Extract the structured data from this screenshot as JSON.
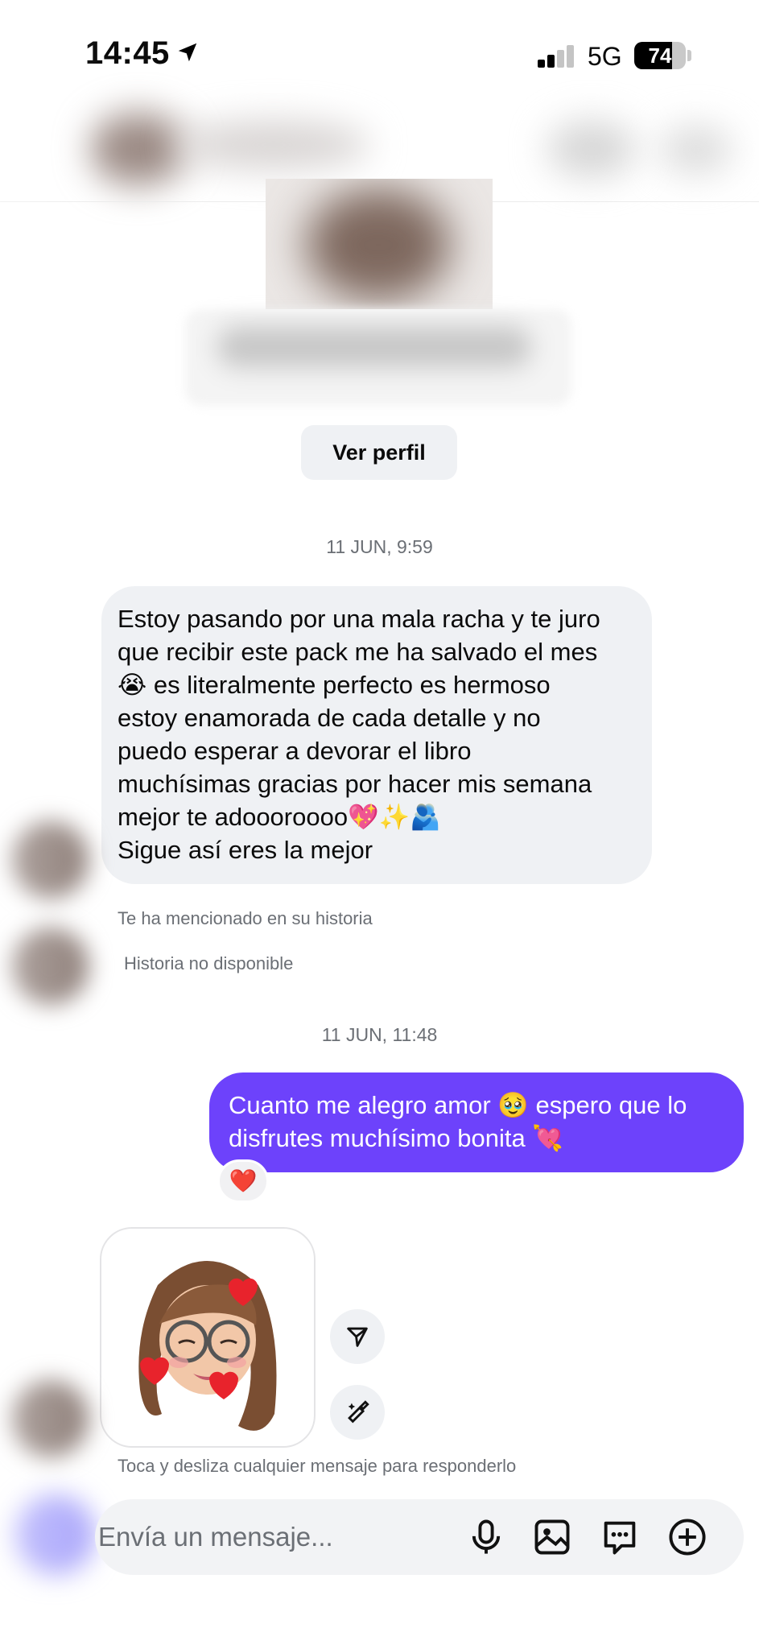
{
  "status_bar": {
    "time": "14:45",
    "network": "5G",
    "battery": "74",
    "battery_level": 0.74,
    "signal_bars_filled": 2,
    "signal_bars_total": 4
  },
  "profile": {
    "view_profile_label": "Ver perfil"
  },
  "thread": {
    "timestamp_1": "11 JUN, 9:59",
    "incoming_message_lines": [
      "Estoy pasando por una mala racha y te juro",
      "que recibir este pack me ha salvado el mes",
      "😭 es literalmente perfecto es hermoso",
      "estoy enamorada de cada detalle y no",
      "puedo esperar a devorar el libro",
      "muchísimas gracias por hacer mis semana",
      "mejor te adoooroooo💖✨🫂",
      "Sigue así eres la mejor"
    ],
    "mention_text": "Te ha mencionado en su historia",
    "story_unavailable": "Historia no disponible",
    "timestamp_2": "11 JUN, 11:48",
    "outgoing_message_lines": [
      "Cuanto me alegro amor 🥹 espero que lo",
      "disfrutes muchísimo bonita 💘"
    ],
    "reaction": "❤️",
    "reply_hint": "Toca y desliza cualquier mensaje para responderlo"
  },
  "composer": {
    "placeholder": "Envía un mensaje..."
  },
  "colors": {
    "outgoing_bubble": "#6d42fb",
    "incoming_bubble": "#eff1f4",
    "secondary_text": "#6b6f75"
  },
  "icons": {
    "location": "location-arrow-icon",
    "send_sticker": "paper-plane-icon",
    "edit_sticker": "magic-brush-icon",
    "microphone": "microphone-icon",
    "gallery": "image-icon",
    "chat_reply": "message-dots-icon",
    "add": "plus-circle-icon"
  }
}
